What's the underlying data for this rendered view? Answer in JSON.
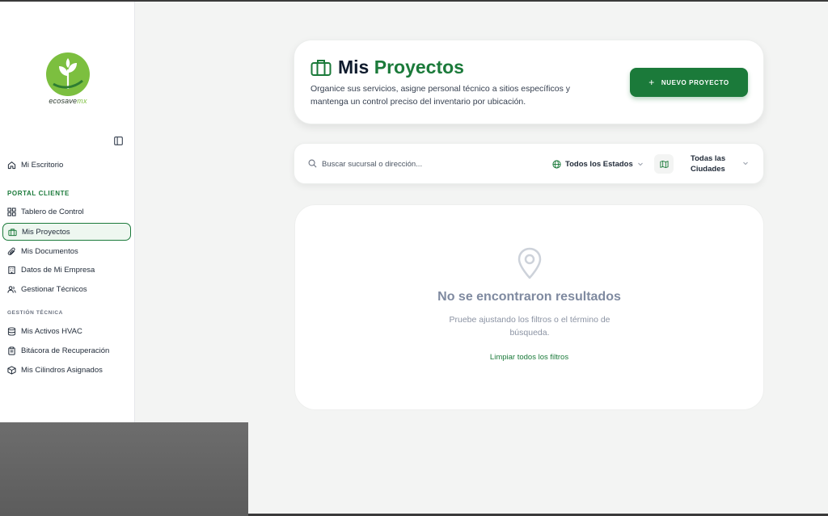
{
  "brand": {
    "logo_text": "ecosave",
    "logo_suffix": "mx",
    "primary_color": "#1b7a3a",
    "accent_color": "#7cbf3f"
  },
  "sidebar": {
    "home": {
      "label": "Mi Escritorio",
      "icon": "home-icon"
    },
    "portal_section": "PORTAL CLIENTE",
    "portal_items": [
      {
        "label": "Tablero de Control",
        "icon": "grid-icon"
      },
      {
        "label": "Mis Proyectos",
        "icon": "briefcase-icon",
        "active": true
      },
      {
        "label": "Mis Documentos",
        "icon": "paperclip-icon"
      },
      {
        "label": "Datos de Mi Empresa",
        "icon": "building-icon"
      },
      {
        "label": "Gestionar Técnicos",
        "icon": "users-icon"
      }
    ],
    "tech_section": "GESTIÓN TÉCNICA",
    "tech_items": [
      {
        "label": "Mis Activos HVAC",
        "icon": "database-icon"
      },
      {
        "label": "Bitácora de Recuperación",
        "icon": "clipboard-icon"
      },
      {
        "label": "Mis Cilindros Asignados",
        "icon": "box-icon"
      }
    ]
  },
  "header": {
    "title_part1": "Mis",
    "title_part2": "Proyectos",
    "subtitle": "Organice sus servicios, asigne personal técnico a sitios específicos y mantenga un control preciso del inventario por ubicación.",
    "new_button": "NUEVO PROYECTO"
  },
  "filters": {
    "search_placeholder": "Buscar sucursal o dirección...",
    "search_value": "",
    "state_selected": "Todos los Estados",
    "city_selected": "Todas las Ciudades"
  },
  "empty_state": {
    "title": "No se encontraron resultados",
    "description": "Pruebe ajustando los filtros o el término de búsqueda.",
    "clear_link": "Limpiar todos los filtros"
  }
}
